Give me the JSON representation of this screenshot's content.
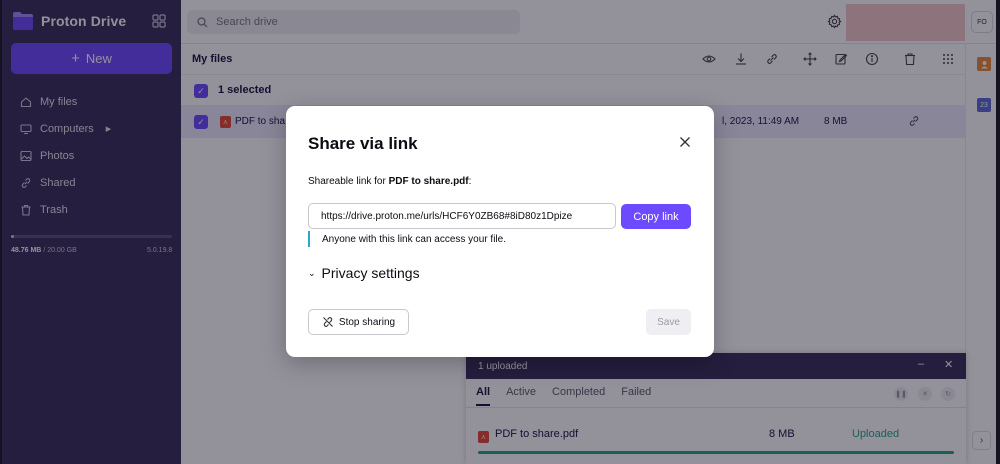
{
  "brand": {
    "name": "Proton Drive",
    "accent": "#6d4aff",
    "sidebar_bg": "#372e58"
  },
  "sidebar": {
    "new_label": "New",
    "items": [
      {
        "label": "My files",
        "icon": "home-icon"
      },
      {
        "label": "Computers",
        "icon": "computer-icon"
      },
      {
        "label": "Photos",
        "icon": "image-icon"
      },
      {
        "label": "Shared",
        "icon": "link-icon"
      },
      {
        "label": "Trash",
        "icon": "trash-icon"
      }
    ],
    "storage_used": "48.76 MB",
    "storage_total": "/ 20.00 GB",
    "storage_fraction": 0.02,
    "version": "5.0.19.8"
  },
  "header": {
    "search_placeholder": "Search drive",
    "avatar_initials": "FO"
  },
  "toolbar": {
    "breadcrumb": "My files"
  },
  "list": {
    "selection_text": "1 selected",
    "file": {
      "name": "PDF to sha",
      "modified": "l, 2023, 11:49 AM",
      "size": "8 MB"
    }
  },
  "rail": {
    "calendar_number": "23"
  },
  "upload": {
    "title": "1 uploaded",
    "tabs": [
      "All",
      "Active",
      "Completed",
      "Failed"
    ],
    "file_name": "PDF to share.pdf",
    "file_size": "8 MB",
    "status": "Uploaded",
    "progress": 1.0
  },
  "modal": {
    "title": "Share via link",
    "label_prefix": "Shareable link for ",
    "label_file": "PDF to share.pdf",
    "label_suffix": ":",
    "link_value": "https://drive.proton.me/urls/HCF6Y0ZB68#8iD80z1Dpize",
    "copy_label": "Copy link",
    "access_note": "Anyone with this link can access your file.",
    "privacy_label": "Privacy settings",
    "stop_label": "Stop sharing",
    "save_label": "Save"
  }
}
